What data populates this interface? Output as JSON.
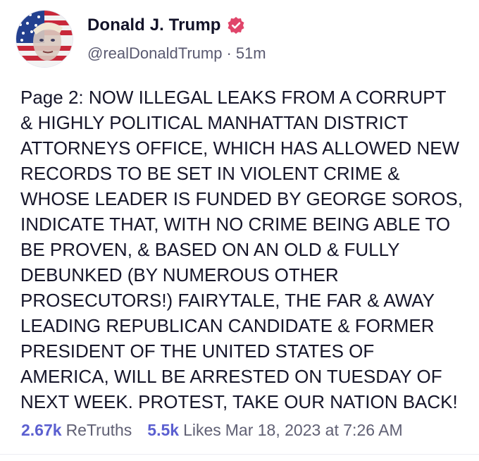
{
  "author": {
    "display_name": "Donald J. Trump",
    "handle": "@realDonaldTrump",
    "separator": "·",
    "time_ago": "51m",
    "verified_icon": "verified-badge-icon"
  },
  "post": {
    "text": "Page 2: NOW ILLEGAL LEAKS FROM A CORRUPT\n& HIGHLY POLITICAL MANHATTAN DISTRICT\nATTORNEYS OFFICE, WHICH HAS ALLOWED NEW\nRECORDS TO BE SET IN VIOLENT CRIME &\nWHOSE LEADER IS FUNDED BY GEORGE SOROS,\nINDICATE THAT, WITH NO CRIME BEING ABLE TO\nBE PROVEN, & BASED ON AN OLD & FULLY\nDEBUNKED (BY NUMEROUS OTHER\nPROSECUTORS!) FAIRYTALE, THE FAR & AWAY\nLEADING REPUBLICAN CANDIDATE & FORMER\nPRESIDENT OF THE UNITED STATES OF\nAMERICA, WILL BE ARRESTED ON TUESDAY OF\nNEXT WEEK. PROTEST, TAKE OUR NATION BACK!"
  },
  "stats": {
    "retruths_count": "2.67k",
    "retruths_label": "ReTruths",
    "likes_count": "5.5k",
    "likes_label": "Likes",
    "timestamp": "Mar 18, 2023 at 7:26 AM"
  },
  "colors": {
    "accent": "#5b5fd0",
    "verified": "#e0456a",
    "text": "#16162a",
    "muted": "#606074"
  }
}
